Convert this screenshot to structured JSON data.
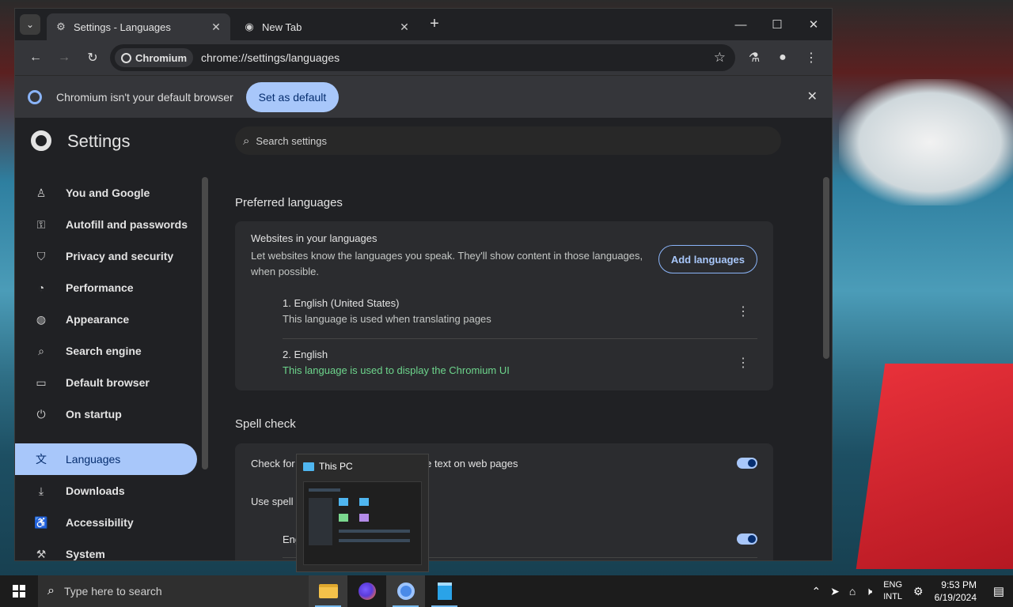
{
  "browser": {
    "tabs": [
      {
        "title": "Settings - Languages",
        "icon": "gear-icon",
        "active": true
      },
      {
        "title": "New Tab",
        "icon": "chromium-icon",
        "active": false
      }
    ],
    "url_chip": "Chromium",
    "url": "chrome://settings/languages",
    "infobar": {
      "text": "Chromium isn't your default browser",
      "button": "Set as default"
    }
  },
  "settings": {
    "title": "Settings",
    "search_placeholder": "Search settings",
    "sidebar": [
      {
        "label": "You and Google",
        "icon": "person-icon"
      },
      {
        "label": "Autofill and passwords",
        "icon": "key-icon"
      },
      {
        "label": "Privacy and security",
        "icon": "shield-icon"
      },
      {
        "label": "Performance",
        "icon": "speedometer-icon"
      },
      {
        "label": "Appearance",
        "icon": "palette-icon"
      },
      {
        "label": "Search engine",
        "icon": "search-icon"
      },
      {
        "label": "Default browser",
        "icon": "browser-window-icon"
      },
      {
        "label": "On startup",
        "icon": "power-icon"
      },
      {
        "label": "Languages",
        "icon": "translate-icon",
        "selected": true
      },
      {
        "label": "Downloads",
        "icon": "download-icon"
      },
      {
        "label": "Accessibility",
        "icon": "accessibility-icon"
      },
      {
        "label": "System",
        "icon": "wrench-icon"
      }
    ],
    "preferred_languages": {
      "section_title": "Preferred languages",
      "heading": "Websites in your languages",
      "description": "Let websites know the languages you speak. They'll show content in those languages, when possible.",
      "add_button": "Add languages",
      "languages": [
        {
          "name": "1. English (United States)",
          "status": "This language is used when translating pages",
          "highlight": false
        },
        {
          "name": "2. English",
          "status": "This language is used to display the Chromium UI",
          "highlight": true
        }
      ]
    },
    "spell_check": {
      "section_title": "Spell check",
      "check_label": "Check for spelling errors when you type text on web pages",
      "check_enabled": true,
      "use_label": "Use spell c",
      "english_label": "Eng",
      "english_enabled": true
    }
  },
  "taskbar": {
    "search_placeholder": "Type here to search",
    "preview_title": "This PC",
    "lang_line1": "ENG",
    "lang_line2": "INTL",
    "time": "9:53 PM",
    "date": "6/19/2024"
  },
  "colors": {
    "accent": "#a8c7fa",
    "green_status": "#6dd58c"
  }
}
